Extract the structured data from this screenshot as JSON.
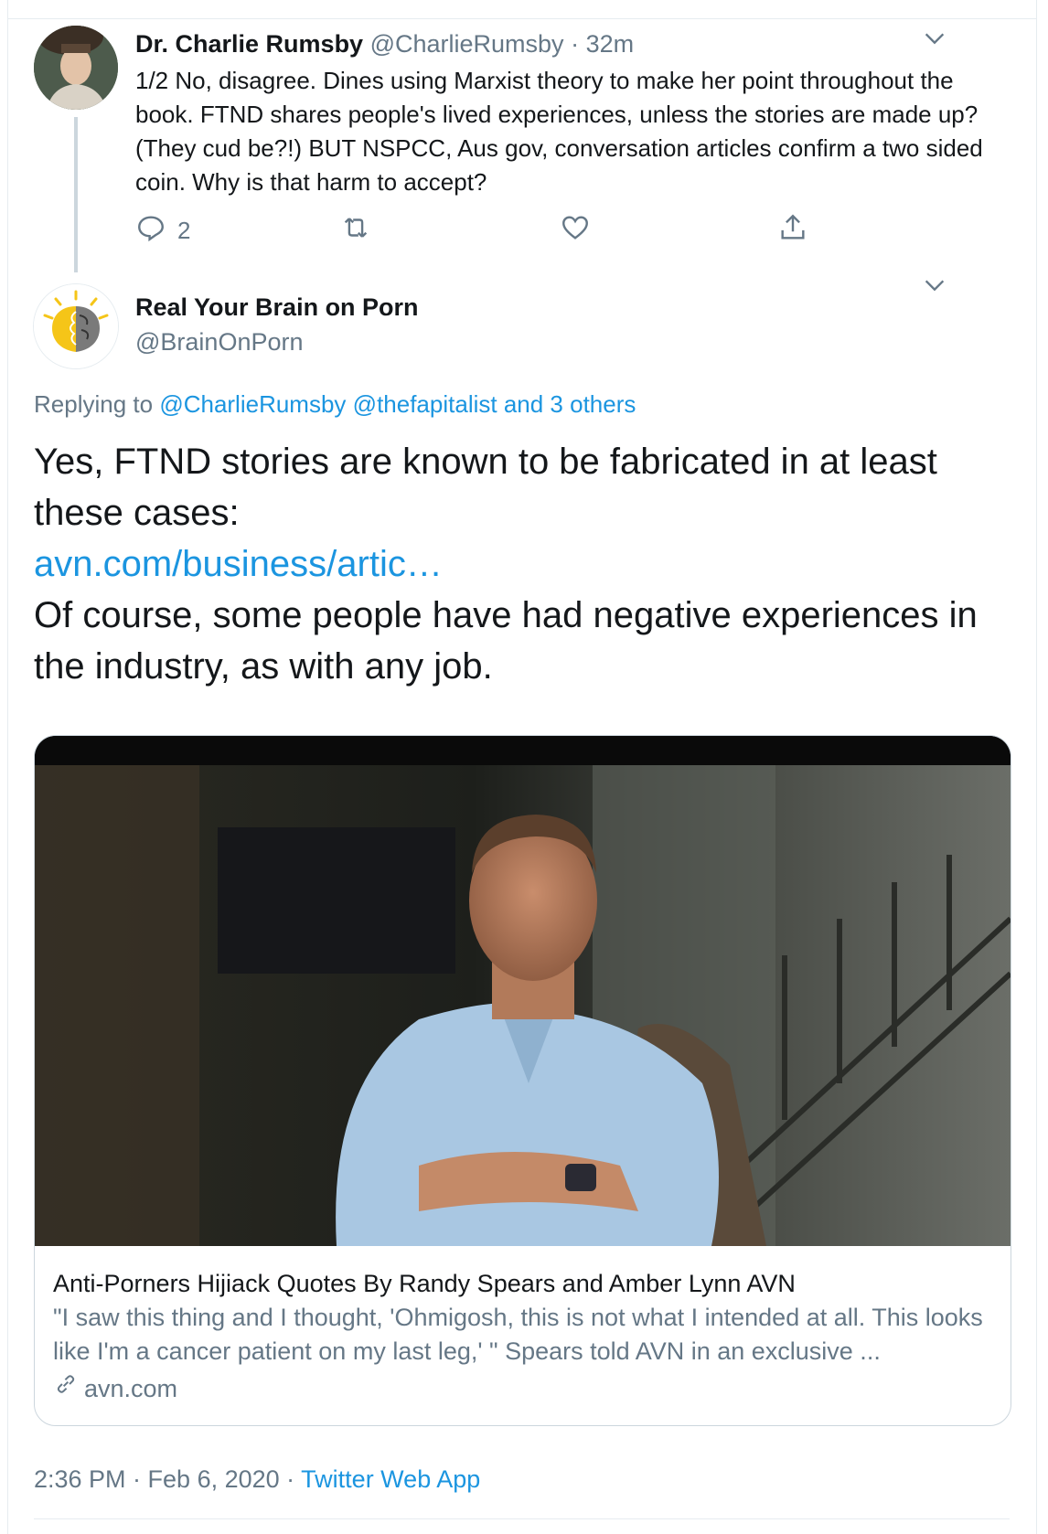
{
  "parent_tweet": {
    "display_name": "Dr. Charlie Rumsby",
    "handle": "@CharlieRumsby",
    "separator": " · ",
    "time": "32m",
    "text": "1/2 No, disagree. Dines using Marxist theory to make her point throughout the book. FTND shares people's lived experiences, unless the stories are made up? (They cud be?!) BUT NSPCC, Aus gov, conversation articles confirm a two sided coin. Why is that harm to accept?",
    "reply_count": "2",
    "icons": [
      "reply-icon",
      "retweet-icon",
      "like-icon",
      "share-icon",
      "chevron-down-icon"
    ]
  },
  "reply_tweet": {
    "display_name": "Real Your Brain on Porn",
    "handle": "@BrainOnPorn",
    "replying_prefix": "Replying to ",
    "replying_mention_1": "@CharlieRumsby",
    "replying_mention_2": "@thefapitalist",
    "replying_others": "and 3 others",
    "text_line_1": "Yes, FTND stories are known to be fabricated in at least these cases:",
    "link": "avn.com/business/artic…",
    "text_line_2": "Of course, some people have had negative experiences in the industry, as with any job.",
    "timestamp": "2:36 PM · Feb 6, 2020",
    "meta_separator": " · ",
    "source": "Twitter Web App"
  },
  "link_card": {
    "title": "Anti-Porners Hijiack Quotes By Randy Spears and Amber Lynn AVN",
    "description": "\"I saw this thing and I thought, 'Ohmigosh, this is not what I intended at all. This looks like I'm a cancer patient on my last leg,' \" Spears told AVN in an exclusive ...",
    "domain": "avn.com",
    "image": "man-in-light-blue-polo-seated-photo"
  },
  "colors": {
    "link": "#1b95e0",
    "secondary_text": "#657786",
    "primary_text": "#14171a",
    "border": "#ccd6dd"
  }
}
